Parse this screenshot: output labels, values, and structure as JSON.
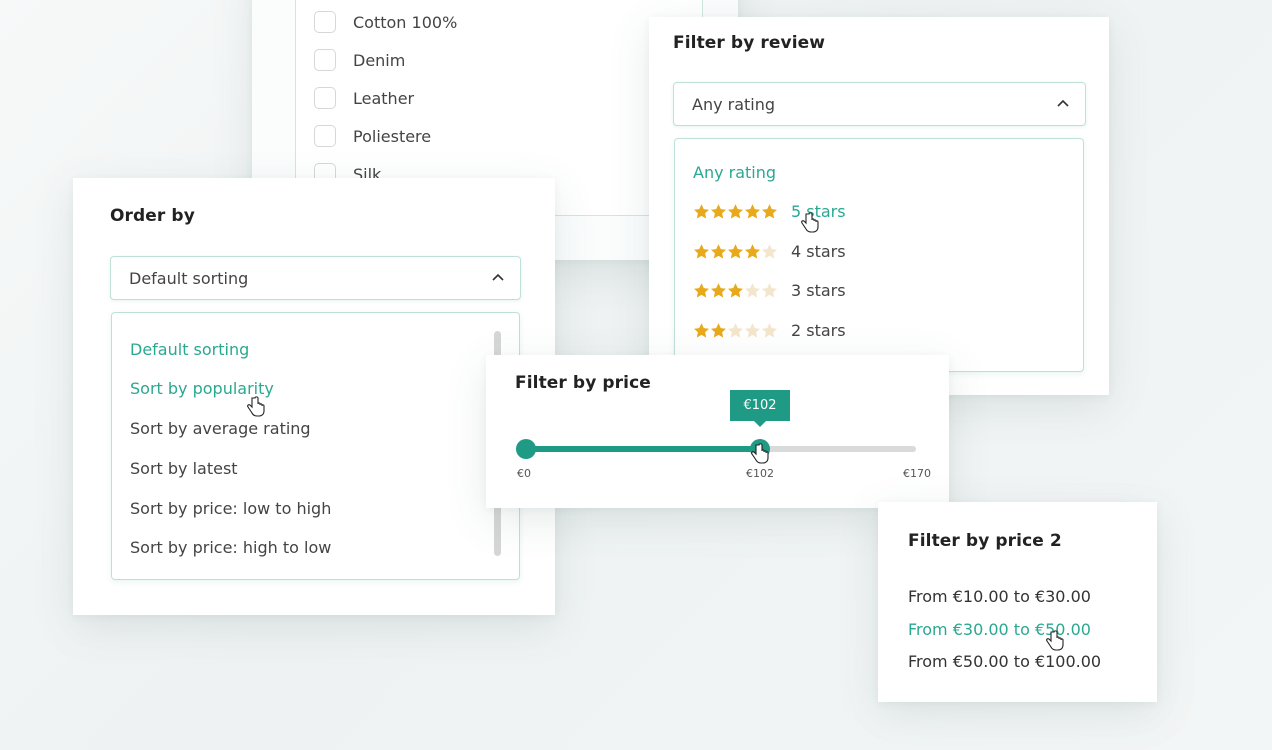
{
  "material_filter": {
    "options": [
      {
        "label": "Cotton 100%",
        "checked": false
      },
      {
        "label": "Denim",
        "checked": false
      },
      {
        "label": "Leather",
        "checked": false
      },
      {
        "label": "Poliestere",
        "checked": false
      },
      {
        "label": "Silk",
        "checked": false
      }
    ]
  },
  "review_filter": {
    "title": "Filter by review",
    "selected": "Any rating",
    "options": [
      {
        "label": "Any rating",
        "stars": 0,
        "highlight": true
      },
      {
        "label": "5 stars",
        "stars": 5,
        "highlight": true
      },
      {
        "label": "4 stars",
        "stars": 4,
        "highlight": false
      },
      {
        "label": "3 stars",
        "stars": 3,
        "highlight": false
      },
      {
        "label": "2 stars",
        "stars": 2,
        "highlight": false
      }
    ]
  },
  "order_by": {
    "title": "Order by",
    "selected": "Default sorting",
    "options": [
      {
        "label": "Default sorting",
        "highlight": true
      },
      {
        "label": "Sort by popularity",
        "highlight": true
      },
      {
        "label": "Sort by average rating",
        "highlight": false
      },
      {
        "label": "Sort by latest",
        "highlight": false
      },
      {
        "label": "Sort by price: low to high",
        "highlight": false
      },
      {
        "label": "Sort by price: high to low",
        "highlight": false
      }
    ]
  },
  "price_filter": {
    "title": "Filter by price",
    "min": 0,
    "max": 170,
    "value": 102,
    "tooltip": "€102",
    "min_label": "€0",
    "value_label": "€102",
    "max_label": "€170"
  },
  "price_filter_2": {
    "title": "Filter by price 2",
    "options": [
      {
        "label": "From €10.00 to €30.00",
        "highlight": false
      },
      {
        "label": "From €30.00 to €50.00",
        "highlight": true
      },
      {
        "label": "From €50.00 to €100.00",
        "highlight": false
      }
    ]
  },
  "colors": {
    "accent": "#1f9b85",
    "accent_text": "#2aa891",
    "star_filled": "#e8a91a",
    "star_empty": "#f3e6cc"
  }
}
